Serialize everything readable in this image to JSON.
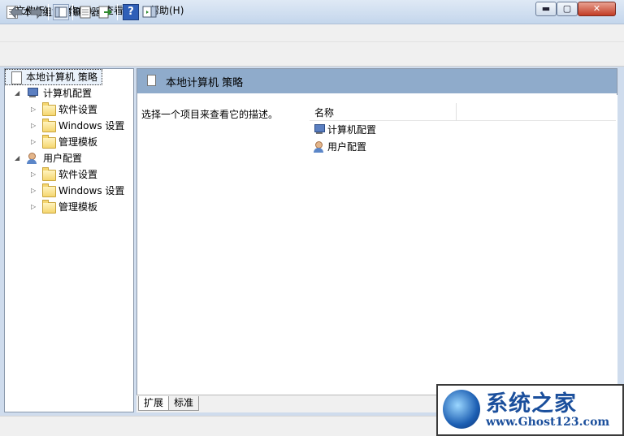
{
  "window": {
    "title": "本地组策略编辑器",
    "controls": {
      "minimize": "▬",
      "maximize": "▢",
      "close": "✕"
    }
  },
  "menu": [
    "文件(F)",
    "操作(A)",
    "查看(V)",
    "帮助(H)"
  ],
  "toolbar": {
    "icons": [
      "back-arrow-icon",
      "forward-arrow-icon",
      "show-hide-tree-icon",
      "properties-icon",
      "export-list-icon",
      "help-icon",
      "show-action-pane-icon"
    ],
    "help_glyph": "?"
  },
  "tree": {
    "root": "本地计算机 策略",
    "computer": {
      "label": "计算机配置",
      "children": [
        "软件设置",
        "Windows 设置",
        "管理模板"
      ]
    },
    "user": {
      "label": "用户配置",
      "children": [
        "软件设置",
        "Windows 设置",
        "管理模板"
      ]
    }
  },
  "right": {
    "header": "本地计算机 策略",
    "description": "选择一个项目来查看它的描述。",
    "column_name": "名称",
    "items": [
      "计算机配置",
      "用户配置"
    ]
  },
  "tabs": [
    "扩展",
    "标准"
  ],
  "watermark": {
    "title": "系统之家",
    "url": "www.Ghost123.com"
  },
  "colors": {
    "header_blue": "#8fabcb",
    "close_red": "#c23c25"
  }
}
